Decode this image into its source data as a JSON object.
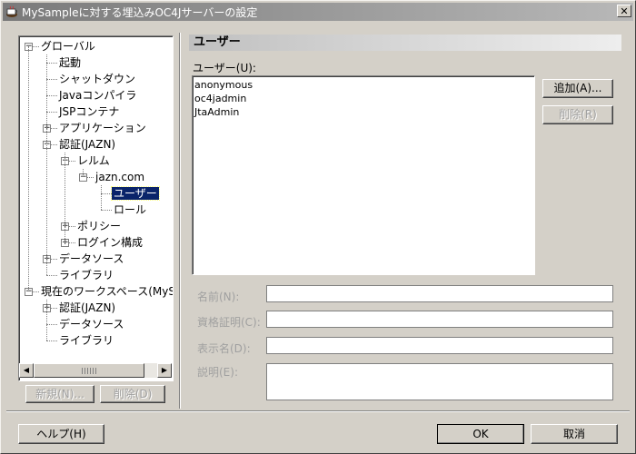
{
  "window": {
    "title": "MySampleに対する埋込みOC4Jサーバーの設定",
    "close_glyph": "✕"
  },
  "tree": {
    "items": [
      {
        "label": "グローバル",
        "expander": "−"
      },
      {
        "label": "起動"
      },
      {
        "label": "シャットダウン"
      },
      {
        "label": "Javaコンパイラ"
      },
      {
        "label": "JSPコンテナ"
      },
      {
        "label": "アプリケーション",
        "expander": "+"
      },
      {
        "label": "認証(JAZN)",
        "expander": "−"
      },
      {
        "label": "レルム",
        "expander": "−"
      },
      {
        "label": "jazn.com",
        "expander": "−"
      },
      {
        "label": "ユーザー",
        "selected": true
      },
      {
        "label": "ロール"
      },
      {
        "label": "ポリシー",
        "expander": "+"
      },
      {
        "label": "ログイン構成",
        "expander": "+"
      },
      {
        "label": "データソース",
        "expander": "+"
      },
      {
        "label": "ライブラリ"
      },
      {
        "label": "現在のワークスペース(MySamp",
        "expander": "−"
      },
      {
        "label": "認証(JAZN)",
        "expander": "+"
      },
      {
        "label": "データソース"
      },
      {
        "label": "ライブラリ"
      }
    ],
    "scroll_left": "◀",
    "scroll_right": "▶",
    "new_button": "新規(N)...",
    "delete_button": "削除(D)"
  },
  "main": {
    "section_title": "ユーザー",
    "users_label": "ユーザー(U):",
    "users": [
      "anonymous",
      "oc4jadmin",
      "JtaAdmin"
    ],
    "add_button": "追加(A)...",
    "remove_button": "削除(R)",
    "fields": [
      {
        "label": "名前(N):",
        "value": ""
      },
      {
        "label": "資格証明(C):",
        "value": ""
      },
      {
        "label": "表示名(D):",
        "value": ""
      },
      {
        "label": "説明(E):",
        "value": ""
      }
    ]
  },
  "footer": {
    "help_button": "ヘルプ(H)",
    "ok_button": "OK",
    "cancel_button": "取消"
  }
}
